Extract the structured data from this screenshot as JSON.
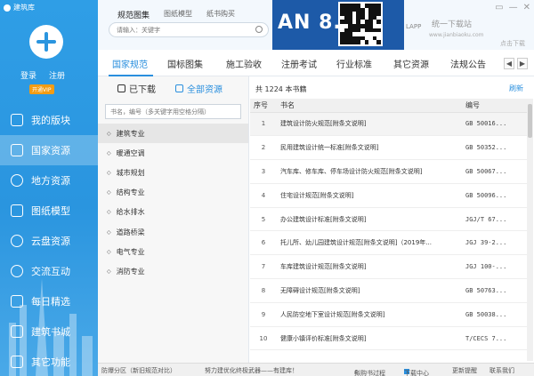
{
  "app": {
    "title": "建筑库"
  },
  "sidebar": {
    "login": "登录",
    "register": "注册",
    "vip": "开通VIP",
    "items": [
      {
        "label": "我的版块",
        "icon": "layers-icon"
      },
      {
        "label": "国家资源",
        "icon": "stack-icon"
      },
      {
        "label": "地方资源",
        "icon": "map-icon"
      },
      {
        "label": "图纸模型",
        "icon": "image-icon"
      },
      {
        "label": "云盘资源",
        "icon": "cloud-icon"
      },
      {
        "label": "交流互动",
        "icon": "chat-icon"
      },
      {
        "label": "每日精选",
        "icon": "star-icon"
      },
      {
        "label": "建筑书城",
        "icon": "book-icon"
      },
      {
        "label": "其它功能",
        "icon": "grid-icon"
      }
    ],
    "active_index": 1
  },
  "header": {
    "tabs": [
      "规范图集",
      "图纸模型",
      "纸书购买"
    ],
    "search_placeholder": "请输入：关键字",
    "banner_text": "AN 8.0",
    "lapp": "LAPP",
    "watermark": "统一下载站",
    "watermark_url": "www.jianbiaoku.com",
    "download_label": "点击下载",
    "window_controls": [
      "▭",
      "—",
      "✕"
    ]
  },
  "category_tabs": [
    "国家规范",
    "国标图集",
    "施工验收",
    "注册考试",
    "行业标准",
    "其它资源",
    "法规公告"
  ],
  "category_nav": {
    "prev": "◀",
    "next": "▶"
  },
  "left_pane": {
    "downloaded": "已下载",
    "all_resources": "全部资源",
    "filter_placeholder": "书名，编号（多关键字用空格分隔）",
    "bullet": "◇",
    "categories": [
      "建筑专业",
      "暖通空调",
      "城市规划",
      "结构专业",
      "给水排水",
      "道路桥梁",
      "电气专业",
      "消防专业"
    ]
  },
  "list": {
    "count": "共 1224 本书籍",
    "refresh": "刷新",
    "columns": [
      "序号",
      "书名",
      "编号"
    ],
    "rows": [
      {
        "no": "1",
        "name": "建筑设计防火规范[附条文说明]",
        "code": "GB 50016..."
      },
      {
        "no": "2",
        "name": "民用建筑设计统一标准[附条文说明]",
        "code": "GB 50352..."
      },
      {
        "no": "3",
        "name": "汽车库、修车库、停车场设计防火规范[附条文说明]",
        "code": "GB 50067..."
      },
      {
        "no": "4",
        "name": "住宅设计规范[附条文说明]",
        "code": "GB 50096..."
      },
      {
        "no": "5",
        "name": "办公建筑设计标准[附条文说明]",
        "code": "JGJ/T 67..."
      },
      {
        "no": "6",
        "name": "托儿所、幼儿园建筑设计规范[附条文说明]（2019年...",
        "code": "JGJ 39-2..."
      },
      {
        "no": "7",
        "name": "车库建筑设计规范[附条文说明]",
        "code": "JGJ 100-..."
      },
      {
        "no": "8",
        "name": "无障碍设计规范[附条文说明]",
        "code": "GB 50763..."
      },
      {
        "no": "9",
        "name": "人民防空地下室设计规范[附条文说明]",
        "code": "GB 50038..."
      },
      {
        "no": "10",
        "name": "健康小镇评价标准[附条文说明]",
        "code": "T/CECS 7..."
      }
    ]
  },
  "status": {
    "left": "防爆分区（新旧规范对比）",
    "mid": "努力建优化终极武器——有建库！",
    "progress": "拟购书过程",
    "progress_value": "4",
    "download_center": "下载中心",
    "update_prompt": "更新提醒",
    "contact": "联系我们"
  }
}
